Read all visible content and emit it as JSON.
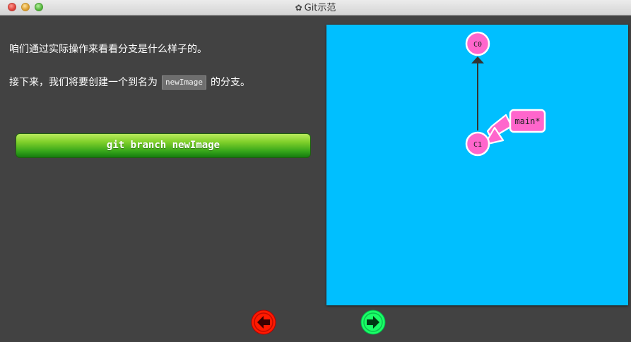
{
  "window": {
    "title": "Git示范",
    "icon": "gear-icon"
  },
  "instructions": {
    "line1": "咱们通过实际操作来看看分支是什么样子的。",
    "line2_before": "接下来，我们将要创建一个到名为",
    "line2_code": "newImage",
    "line2_after": "的分支。"
  },
  "command_button": {
    "label": "git branch newImage"
  },
  "visualization": {
    "background": "#00bfff",
    "commit_color": "#ff66cc",
    "commits": [
      {
        "id": "C0"
      },
      {
        "id": "C1"
      }
    ],
    "branch_label": "main*"
  },
  "navigation": {
    "prev_icon": "left-arrow-icon",
    "next_icon": "right-arrow-icon",
    "prev_color": "#ff0000",
    "next_color": "#00ff66"
  }
}
